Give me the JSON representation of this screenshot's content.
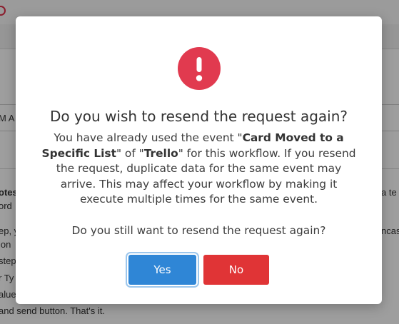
{
  "background": {
    "field_text": "M A",
    "lines": [
      {
        "text": "otes",
        "bold": true
      },
      {
        "text": "ord",
        "bold": false
      },
      {
        "text": "ep, y",
        "bold": false
      },
      {
        "text": "ion",
        "bold": false
      },
      {
        "text": "step",
        "bold": false
      },
      {
        "text": "r Ty",
        "bold": false
      },
      {
        "text": "alue",
        "bold": false
      },
      {
        "text": "and send button. That's it.",
        "bold": false
      }
    ],
    "right_fragments": [
      "a te",
      "ncas"
    ]
  },
  "dialog": {
    "icon": "exclamation-icon",
    "icon_color": "#e13a4f",
    "title": "Do you wish to resend the request again?",
    "body": {
      "part1": "You have already used the event \"",
      "event_name": "Card Moved to a Specific List",
      "part2": "\" of \"",
      "app_name": "Trello",
      "part3": "\" for this workflow. If you resend the request, duplicate data for the same event may arrive. This may affect your workflow by making it execute multiple times for the same event."
    },
    "question": "Do you still want to resend the request again?",
    "yes_label": "Yes",
    "no_label": "No",
    "yes_color": "#2f86d6",
    "no_color": "#e03436"
  }
}
